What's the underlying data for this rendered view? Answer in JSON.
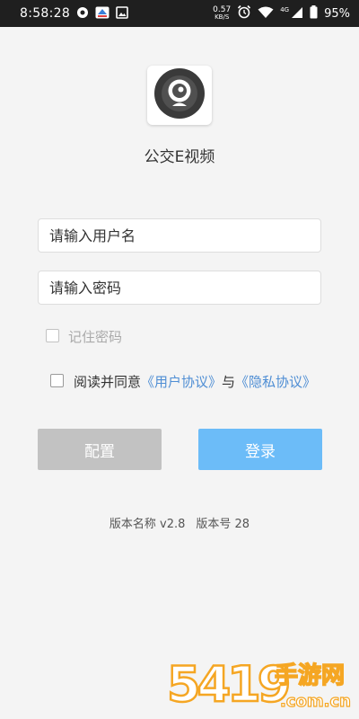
{
  "status_bar": {
    "time": "8:58:28",
    "net_speed_value": "0.57",
    "net_speed_unit": "KB/S",
    "network_type": "4G",
    "battery": "95%"
  },
  "app": {
    "name": "公交E视频"
  },
  "form": {
    "username_placeholder": "请输入用户名",
    "password_placeholder": "请输入密码",
    "remember_label": "记住密码",
    "agree_prefix": "阅读并同意",
    "user_agreement": "《用户协议》",
    "agree_and": "与",
    "privacy_policy": "《隐私协议》"
  },
  "buttons": {
    "config": "配置",
    "login": "登录"
  },
  "version": {
    "name_text": "版本名称 v2.8",
    "code_text": "版本号 28"
  },
  "watermark": {
    "digits": "5419",
    "site_name": "手游网",
    "domain": ".com.cn"
  },
  "colors": {
    "status_bar": "#1f1f1f",
    "background": "#f4f4f4",
    "link": "#4f8ed4",
    "login_button": "#6cbcf8",
    "config_button": "#c2c2c2",
    "watermark": "#f5a623"
  }
}
